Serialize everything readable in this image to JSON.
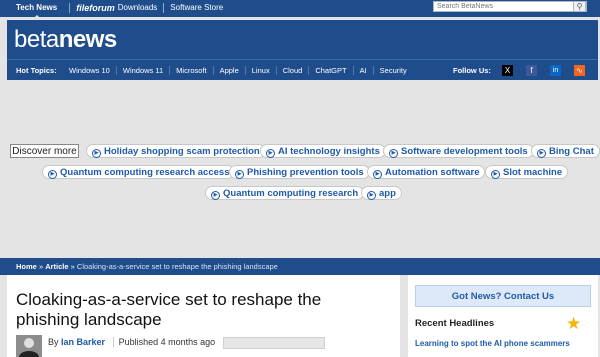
{
  "topnav": {
    "tech_news": "Tech News",
    "fileforum": "fileforum",
    "downloads": "Downloads",
    "software_store": "Software Store",
    "search_placeholder": "Search BetaNews"
  },
  "brand": {
    "part1": "beta",
    "part2": "news"
  },
  "hot_topics": {
    "label": "Hot Topics:",
    "items": [
      "Windows 10",
      "Windows 11",
      "Microsoft",
      "Apple",
      "Linux",
      "Cloud",
      "ChatGPT",
      "AI",
      "Security"
    ],
    "follow_label": "Follow Us:"
  },
  "discover": {
    "label": "Discover more",
    "pills": [
      "Holiday shopping scam protection",
      "AI technology insights",
      "Software development tools",
      "Bing Chat",
      "Quantum computing research access",
      "Phishing prevention tools",
      "Automation software",
      "Slot machine",
      "Quantum computing research",
      "app"
    ]
  },
  "breadcrumb": {
    "home": "Home",
    "article": "Article",
    "sep": "»",
    "current": "Cloaking-as-a-service set to reshape the phishing landscape"
  },
  "article": {
    "title": "Cloaking-as-a-service set to reshape the phishing landscape",
    "by": "By",
    "author": "Ian Barker",
    "published": "Published 4 months ago"
  },
  "sidebar": {
    "contact": "Got News? Contact Us",
    "recent_headlines": "Recent Headlines",
    "headline1": "Learning to spot the AI phone scammers"
  },
  "colors": {
    "navy": "#1f4d8c",
    "link": "#1f5aa8",
    "star": "#f2b705"
  }
}
